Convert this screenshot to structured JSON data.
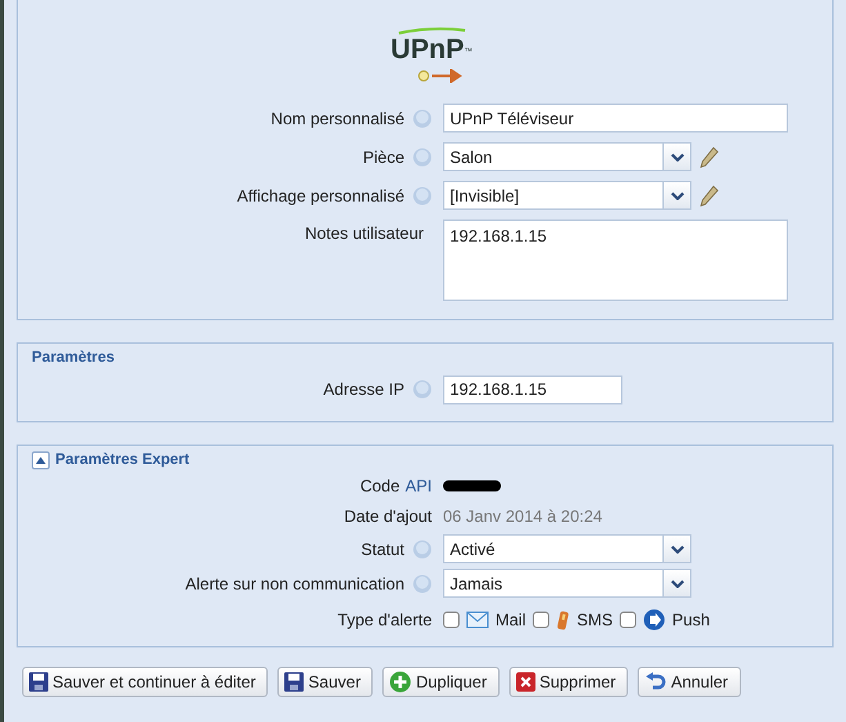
{
  "logo": {
    "text": "UPnP",
    "mark": "™"
  },
  "general": {
    "fields": [
      {
        "kind": "text",
        "label": "Nom personnalisé",
        "help": true,
        "value": "UPnP Téléviseur"
      },
      {
        "kind": "select",
        "label": "Pièce",
        "help": true,
        "value": "Salon",
        "editable": true
      },
      {
        "kind": "select",
        "label": "Affichage personnalisé",
        "help": true,
        "value": "[Invisible]",
        "editable": true
      },
      {
        "kind": "textarea",
        "label": "Notes utilisateur",
        "help": false,
        "value": "192.168.1.15"
      }
    ]
  },
  "parametres": {
    "legend": "Paramètres",
    "fields": [
      {
        "kind": "short",
        "label": "Adresse IP",
        "help": true,
        "value": "192.168.1.15"
      }
    ]
  },
  "expert": {
    "legend": "Paramètres Expert",
    "expanded": true,
    "code_label": "Code",
    "code_link": "API",
    "date_label": "Date d'ajout",
    "date_value": "06 Janv 2014 à 20:24",
    "fields": [
      {
        "kind": "select",
        "label": "Statut",
        "help": true,
        "value": "Activé",
        "editable": false
      },
      {
        "kind": "select",
        "label": "Alerte sur non communication",
        "help": true,
        "value": "Jamais",
        "editable": false
      }
    ],
    "alert_label": "Type d'alerte",
    "alerts": [
      {
        "kind": "mail",
        "label": "Mail",
        "checked": false
      },
      {
        "kind": "sms",
        "label": "SMS",
        "checked": false
      },
      {
        "kind": "push",
        "label": "Push",
        "checked": false
      }
    ]
  },
  "buttons": [
    {
      "kind": "save",
      "label": "Sauver et continuer à éditer"
    },
    {
      "kind": "save",
      "label": "Sauver"
    },
    {
      "kind": "add",
      "label": "Dupliquer"
    },
    {
      "kind": "delete",
      "label": "Supprimer"
    },
    {
      "kind": "undo",
      "label": "Annuler"
    }
  ]
}
